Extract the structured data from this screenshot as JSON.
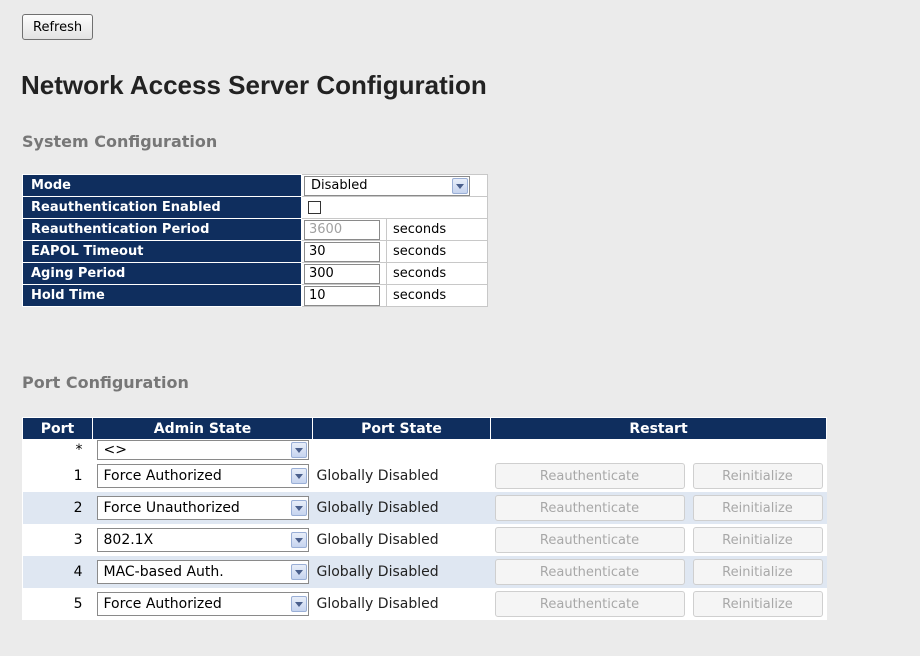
{
  "toolbar": {
    "refresh_label": "Refresh"
  },
  "page": {
    "title": "Network Access Server Configuration"
  },
  "system": {
    "section_title": "System Configuration",
    "mode": {
      "label": "Mode",
      "value": "Disabled"
    },
    "reauth_enabled": {
      "label": "Reauthentication Enabled",
      "checked": false
    },
    "reauth_period": {
      "label": "Reauthentication Period",
      "value": "3600",
      "unit": "seconds"
    },
    "eapol_timeout": {
      "label": "EAPOL Timeout",
      "value": "30",
      "unit": "seconds"
    },
    "aging_period": {
      "label": "Aging Period",
      "value": "300",
      "unit": "seconds"
    },
    "hold_time": {
      "label": "Hold Time",
      "value": "10",
      "unit": "seconds"
    }
  },
  "ports": {
    "section_title": "Port Configuration",
    "headers": {
      "port": "Port",
      "admin_state": "Admin State",
      "port_state": "Port State",
      "restart": "Restart"
    },
    "wildcard": {
      "port": "*",
      "admin_state": "<>"
    },
    "rows": [
      {
        "port": "1",
        "admin_state": "Force Authorized",
        "port_state": "Globally Disabled",
        "reauth_label": "Reauthenticate",
        "reinit_label": "Reinitialize"
      },
      {
        "port": "2",
        "admin_state": "Force Unauthorized",
        "port_state": "Globally Disabled",
        "reauth_label": "Reauthenticate",
        "reinit_label": "Reinitialize"
      },
      {
        "port": "3",
        "admin_state": "802.1X",
        "port_state": "Globally Disabled",
        "reauth_label": "Reauthenticate",
        "reinit_label": "Reinitialize"
      },
      {
        "port": "4",
        "admin_state": "MAC-based Auth.",
        "port_state": "Globally Disabled",
        "reauth_label": "Reauthenticate",
        "reinit_label": "Reinitialize"
      },
      {
        "port": "5",
        "admin_state": "Force Authorized",
        "port_state": "Globally Disabled",
        "reauth_label": "Reauthenticate",
        "reinit_label": "Reinitialize"
      }
    ]
  },
  "colors": {
    "header_bg": "#0f2e5e",
    "even_row_bg": "#dfe7f2",
    "page_bg": "#ebebeb"
  }
}
